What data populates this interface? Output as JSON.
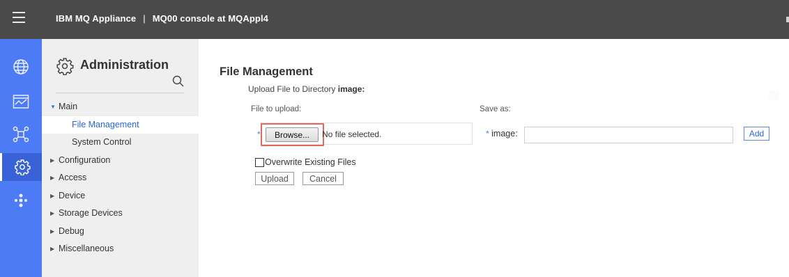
{
  "header": {
    "product": "IBM MQ Appliance",
    "separator": "|",
    "context": "MQ00 console at MQAppl4"
  },
  "icons": {
    "menu": "hamburger-icon",
    "rail": [
      "globe-icon",
      "monitor-icon",
      "network-icon",
      "gear-icon",
      "flow-icon"
    ],
    "search": "search-icon"
  },
  "colors": {
    "topbar": "#4a4a4a",
    "rail": "#4d7af5",
    "accent": "#2a66d9",
    "highlight": "#e06a5c"
  },
  "sidebar": {
    "title": "Administration",
    "items": [
      {
        "label": "Main",
        "expanded": true
      },
      {
        "label": "File Management",
        "selected": true
      },
      {
        "label": "System Control"
      },
      {
        "label": "Configuration"
      },
      {
        "label": "Access"
      },
      {
        "label": "Device"
      },
      {
        "label": "Storage Devices"
      },
      {
        "label": "Debug"
      },
      {
        "label": "Miscellaneous"
      }
    ]
  },
  "main": {
    "title": "File Management",
    "upload_prefix": "Upload File to Directory",
    "directory": "image:",
    "file_label": "File to upload:",
    "saveas_label": "Save as:",
    "required_mark": "*",
    "browse_label": "Browse...",
    "file_status": "No file selected.",
    "saveas_field_label": "image:",
    "saveas_value": "",
    "add_label": "Add",
    "overwrite_label": "Overwrite Existing Files",
    "upload_label": "Upload",
    "cancel_label": "Cancel"
  }
}
